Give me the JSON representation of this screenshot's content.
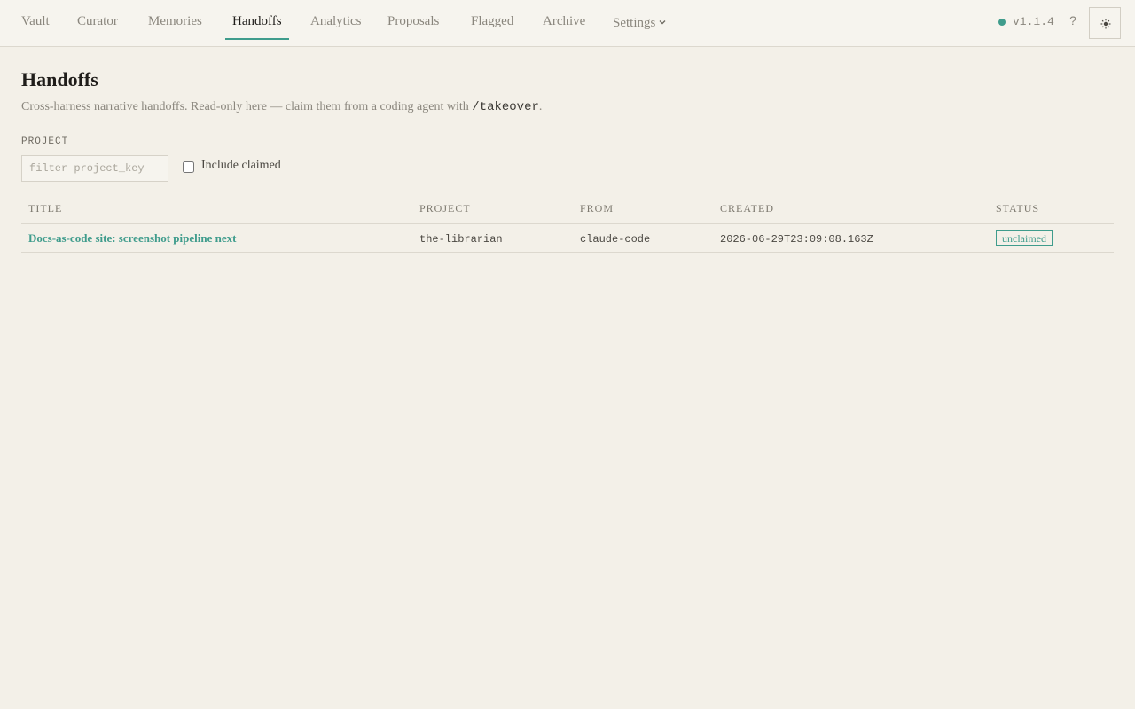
{
  "nav": {
    "tabs": [
      {
        "label": "Vault"
      },
      {
        "label": "Curator"
      },
      {
        "label": "Memories"
      },
      {
        "label": "Handoffs"
      },
      {
        "label": "Analytics"
      },
      {
        "label": "Proposals"
      },
      {
        "label": "Flagged"
      },
      {
        "label": "Archive"
      },
      {
        "label": "Settings"
      }
    ],
    "active_tab": "Handoffs",
    "version": "v1.1.4",
    "help_label": "?",
    "status_color": "#3f9c8c",
    "icons": {
      "status": "status-dot-icon",
      "settings_caret": "chevron-down-icon",
      "theme": "sun-icon"
    }
  },
  "page": {
    "title": "Handoffs",
    "subtitle_before": "Cross-harness narrative handoffs. Read-only here — claim them from a coding agent with ",
    "subtitle_code": "/takeover",
    "subtitle_after": "."
  },
  "filters": {
    "project_label": "PROJECT",
    "project_placeholder": "filter project_key",
    "project_value": "",
    "include_claimed_label": "Include claimed",
    "include_claimed_checked": false
  },
  "table": {
    "columns": [
      "TITLE",
      "PROJECT",
      "FROM",
      "CREATED",
      "STATUS"
    ],
    "rows": [
      {
        "title": "Docs-as-code site: screenshot pipeline next",
        "project": "the-librarian",
        "from": "claude-code",
        "created": "2026-06-29T23:09:08.163Z",
        "status": "unclaimed"
      }
    ]
  },
  "colors": {
    "accent": "#3f9c8c",
    "background": "#f3f0e8"
  }
}
